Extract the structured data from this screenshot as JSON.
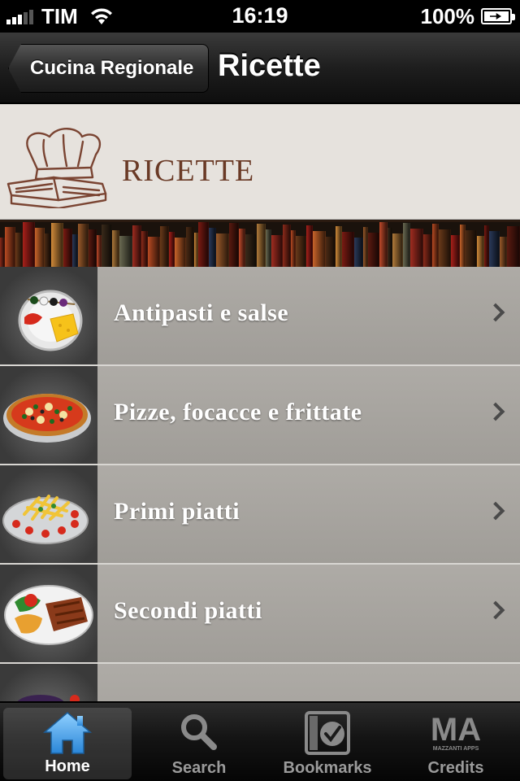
{
  "status_bar": {
    "carrier": "TIM",
    "time": "16:19",
    "battery": "100%"
  },
  "nav": {
    "back_label": "Cucina Regionale",
    "title": "Ricette"
  },
  "banner": {
    "title": "RICETTE"
  },
  "list": {
    "items": [
      {
        "label": "Antipasti e salse",
        "icon": "appetizer-plate-icon"
      },
      {
        "label": "Pizze, focacce e frittate",
        "icon": "pizza-icon"
      },
      {
        "label": "Primi piatti",
        "icon": "pasta-plate-icon"
      },
      {
        "label": "Secondi piatti",
        "icon": "meat-plate-icon"
      }
    ]
  },
  "tabs": [
    {
      "label": "Home",
      "icon": "home-icon",
      "active": true
    },
    {
      "label": "Search",
      "icon": "search-icon",
      "active": false
    },
    {
      "label": "Bookmarks",
      "icon": "bookmark-check-icon",
      "active": false
    },
    {
      "label": "Credits",
      "icon": "ma-logo-icon",
      "active": false
    }
  ],
  "credits_logo": {
    "letters": "MA",
    "subtitle": "MAZZANTI APPS"
  },
  "colors": {
    "accent_blue": "#4aa3e8",
    "banner_text": "#6a3a26"
  }
}
